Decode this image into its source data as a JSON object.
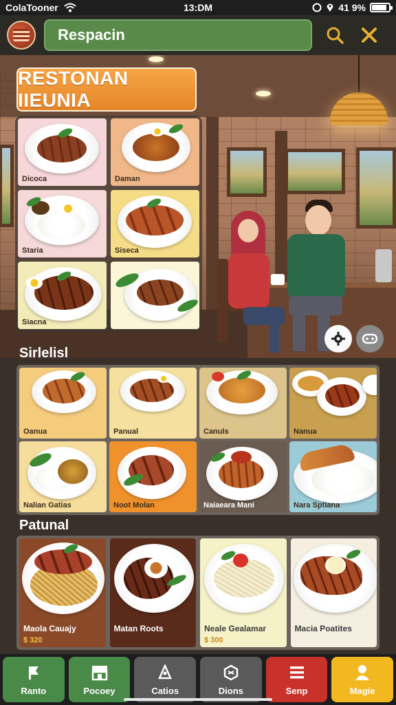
{
  "status_bar": {
    "carrier": "ColaTooner",
    "time": "13:DM",
    "battery": "41 9%",
    "battery_level": 0.8
  },
  "header": {
    "search_text": "Respacin",
    "icons": [
      "restaurant-avatar-icon",
      "search-icon",
      "close-icon"
    ]
  },
  "restaurant": {
    "title": "RESTONAN IIEUNIA",
    "dishes": [
      {
        "label": "Dicoca",
        "bg": "#f6d6d8"
      },
      {
        "label": "Daman",
        "bg": "#f0b888"
      },
      {
        "label": "Staria",
        "bg": "#f5d8d8"
      },
      {
        "label": "Siseca",
        "bg": "#f5dd88"
      },
      {
        "label": "Siacna",
        "bg": "#f3ebb8"
      },
      {
        "label": "",
        "bg": "#fbf6d8"
      }
    ]
  },
  "specials": {
    "title": "Sirlelisl",
    "items": [
      {
        "label": "Oanua",
        "bg": "#f5cb7c"
      },
      {
        "label": "Panual",
        "bg": "#f5e0a0"
      },
      {
        "label": "Canuls",
        "bg": "#dcc48a"
      },
      {
        "label": "Nanua",
        "bg": "#c8a050"
      },
      {
        "label": "Nalian Gatias",
        "bg": "#f7dd9c"
      },
      {
        "label": "Noot Molan",
        "bg": "#f0922c"
      },
      {
        "label": "Naiaeara Mani",
        "bg": "#6a5c50"
      },
      {
        "label": "Nara Sptiana",
        "bg": "#9ccbd8"
      }
    ]
  },
  "popular": {
    "title": "Patunal",
    "items": [
      {
        "label": "Maola Cauajy",
        "price": "$ 320",
        "bg": "#8a4a2a"
      },
      {
        "label": "Matan Roots",
        "price": "",
        "bg": "#5a2a1a"
      },
      {
        "label": "Neale Gealamar",
        "price": "$ 300",
        "bg": "#f6f2c8"
      },
      {
        "label": "Macia Poatites",
        "price": "",
        "bg": "#f5efe2"
      }
    ]
  },
  "scene": {
    "buttons": [
      "settings-gear-icon",
      "game-controller-icon"
    ]
  },
  "bottom_nav": [
    {
      "label": "Ranto",
      "icon": "flag-icon",
      "bg": "#4a8a48"
    },
    {
      "label": "Pocoey",
      "icon": "storefront-icon",
      "bg": "#4a8a48"
    },
    {
      "label": "Catios",
      "icon": "chef-icon",
      "bg": "#5a5a5a"
    },
    {
      "label": "Dions",
      "icon": "bell-icon",
      "bg": "#5a5a5a"
    },
    {
      "label": "Senp",
      "icon": "menu-list-icon",
      "bg": "#c8322a"
    },
    {
      "label": "Magie",
      "icon": "person-icon",
      "bg": "#f2b820"
    }
  ]
}
